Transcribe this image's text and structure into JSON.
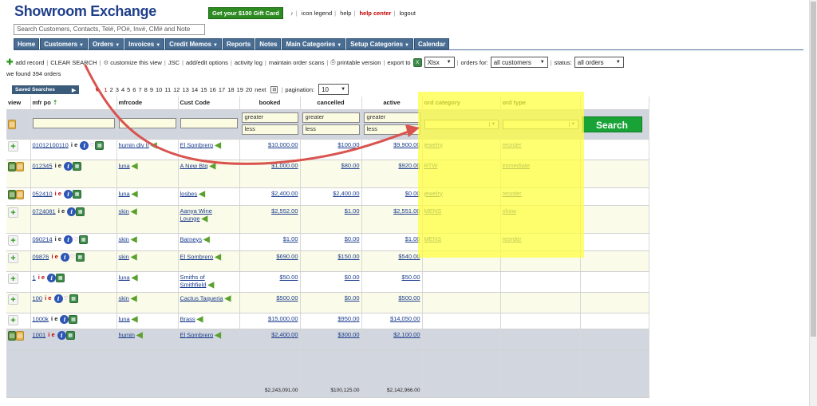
{
  "header": {
    "logo": "Showroom Exchange",
    "gift_card": "Get your $100 Gift Card",
    "links": [
      "icon legend",
      "help",
      "help center",
      "logout"
    ],
    "search_value": "Search Customers, Contacts, Tel#, PO#, Inv#, CM# and Note"
  },
  "nav": [
    {
      "label": "Home",
      "caret": ""
    },
    {
      "label": "Customers",
      "caret": "▼"
    },
    {
      "label": "Orders",
      "caret": "▼"
    },
    {
      "label": "Invoices",
      "caret": "▼"
    },
    {
      "label": "Credit Memos",
      "caret": "▼"
    },
    {
      "label": "Reports",
      "caret": ""
    },
    {
      "label": "Notes",
      "caret": ""
    },
    {
      "label": "Main Categories",
      "caret": "▼"
    },
    {
      "label": "Setup Categories",
      "caret": "▼"
    },
    {
      "label": "Calendar",
      "caret": ""
    }
  ],
  "toolbar": {
    "add_record": "add record",
    "clear_search": "CLEAR SEARCH",
    "customize": "customize this view",
    "jsc": "JSC",
    "add_edit_options": "add/edit options",
    "activity_log": "activity log",
    "maintain_scans": "maintain order scans",
    "printable": "printable version",
    "export_to": "export to",
    "export_format": "Xlsx",
    "orders_for_label": "orders for:",
    "orders_for_value": "all customers",
    "status_label": "status:",
    "status_value": "all orders"
  },
  "found_text": "we found 394 orders",
  "saved_searches": "Saved Searches",
  "pager": {
    "pages": [
      "1",
      "2",
      "3",
      "4",
      "5",
      "6",
      "7",
      "8",
      "9",
      "10",
      "11",
      "12",
      "13",
      "14",
      "15",
      "16",
      "17",
      "18",
      "19",
      "20"
    ],
    "next": "next",
    "pagination_label": "pagination:",
    "pagination_value": "10"
  },
  "columns": [
    "view",
    "mfr po",
    "mfrcode",
    "Cust Code",
    "booked",
    "cancelled",
    "active",
    "ord category",
    "ord type"
  ],
  "filters": {
    "greater": "greater",
    "less": "less",
    "search_button": "Search"
  },
  "rows": [
    {
      "po": "01012100110",
      "mfrcode": "humin div II",
      "cust": "El Sombrero",
      "booked": "$10,000.00",
      "cancelled": "$100.00",
      "active": "$9,900.00",
      "category": "jewelry",
      "type": "reorder"
    },
    {
      "po": "012345",
      "mfrcode": "luna",
      "cust": "A New Btq",
      "booked": "$1,000.00",
      "cancelled": "$80.00",
      "active": "$920.00",
      "category": "RTW",
      "type": "immediate"
    },
    {
      "po": "052410",
      "mfrcode": "luna",
      "cust": "losbes",
      "booked": "$2,400.00",
      "cancelled": "$2,400.00",
      "active": "$0.00",
      "category": "jewelry",
      "type": "reorder"
    },
    {
      "po": "0724081",
      "mfrcode": "skin",
      "cust": "Aanya Wine Lounge",
      "booked": "$2,552.00",
      "cancelled": "$1.00",
      "active": "$2,551.00",
      "category": "MENS",
      "type": "show"
    },
    {
      "po": "090214",
      "mfrcode": "skin",
      "cust": "Barneys",
      "booked": "$1.00",
      "cancelled": "$0.00",
      "active": "$1.00",
      "category": "MENS",
      "type": "reorder"
    },
    {
      "po": "09876",
      "mfrcode": "skin",
      "cust": "El Sombrero",
      "booked": "$690.00",
      "cancelled": "$150.00",
      "active": "$540.00",
      "category": "",
      "type": ""
    },
    {
      "po": "1",
      "mfrcode": "luna",
      "cust": "Smiths of Smithfield",
      "booked": "$50.00",
      "cancelled": "$0.00",
      "active": "$50.00",
      "category": "",
      "type": ""
    },
    {
      "po": "100",
      "mfrcode": "skin",
      "cust": "Cactus Taqueria",
      "booked": "$500.00",
      "cancelled": "$0.00",
      "active": "$500.00",
      "category": "",
      "type": ""
    },
    {
      "po": "1000k",
      "mfrcode": "luna",
      "cust": "Brass",
      "booked": "$15,000.00",
      "cancelled": "$950.00",
      "active": "$14,050.00",
      "category": "",
      "type": ""
    },
    {
      "po": "1001",
      "mfrcode": "humin",
      "cust": "El Sombrero",
      "booked": "$2,400.00",
      "cancelled": "$300.00",
      "active": "$2,100.00",
      "category": "",
      "type": ""
    }
  ],
  "totals": {
    "booked": "$2,243,091.00",
    "cancelled": "$100,125.00",
    "active": "$2,142,966.00"
  },
  "colors": {
    "nav": "#4a6e93",
    "highlight": "#ffff3c",
    "search_button": "#18a336",
    "annotation_arrow": "#d9534f"
  }
}
